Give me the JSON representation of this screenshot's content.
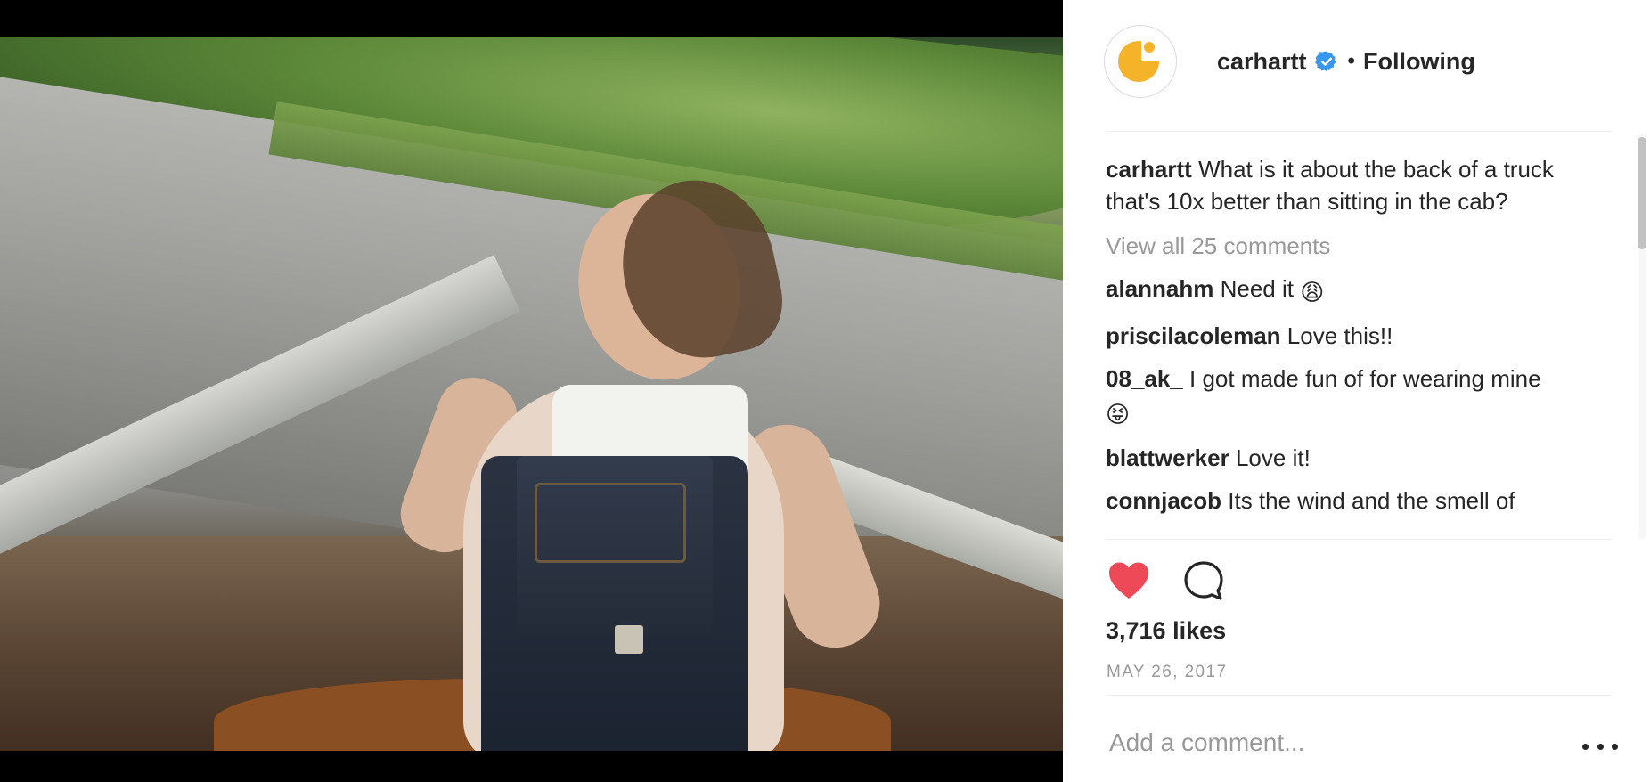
{
  "post": {
    "username": "carhartt",
    "follow_status": "Following",
    "separator": "•",
    "caption_text": "What is it about the back of a truck that's 10x better than sitting in the cab?",
    "view_all_comments": "View all 25 comments",
    "likes": "3,716 likes",
    "date": "MAY 26, 2017",
    "add_comment_placeholder": "Add a comment...",
    "comments": [
      {
        "user": "alannahm",
        "text": "Need it",
        "emoji": "😩"
      },
      {
        "user": "priscilacoleman",
        "text": "Love this!!",
        "emoji": ""
      },
      {
        "user": "08_ak_",
        "text": "I got made fun of for wearing mine",
        "emoji": "😝"
      },
      {
        "user": "blattwerker",
        "text": "Love it!",
        "emoji": ""
      },
      {
        "user": "connjacob",
        "text": "Its the wind and the smell of",
        "emoji": ""
      }
    ]
  },
  "icons": {
    "verified": "verified-badge-icon",
    "like": "heart-icon",
    "comment": "comment-bubble-icon",
    "more": "more-options-icon"
  },
  "colors": {
    "like_red": "#ed4956",
    "verified_blue": "#3897f0",
    "brand_yellow": "#f5b32a",
    "muted_text": "#999999",
    "text": "#262626"
  }
}
